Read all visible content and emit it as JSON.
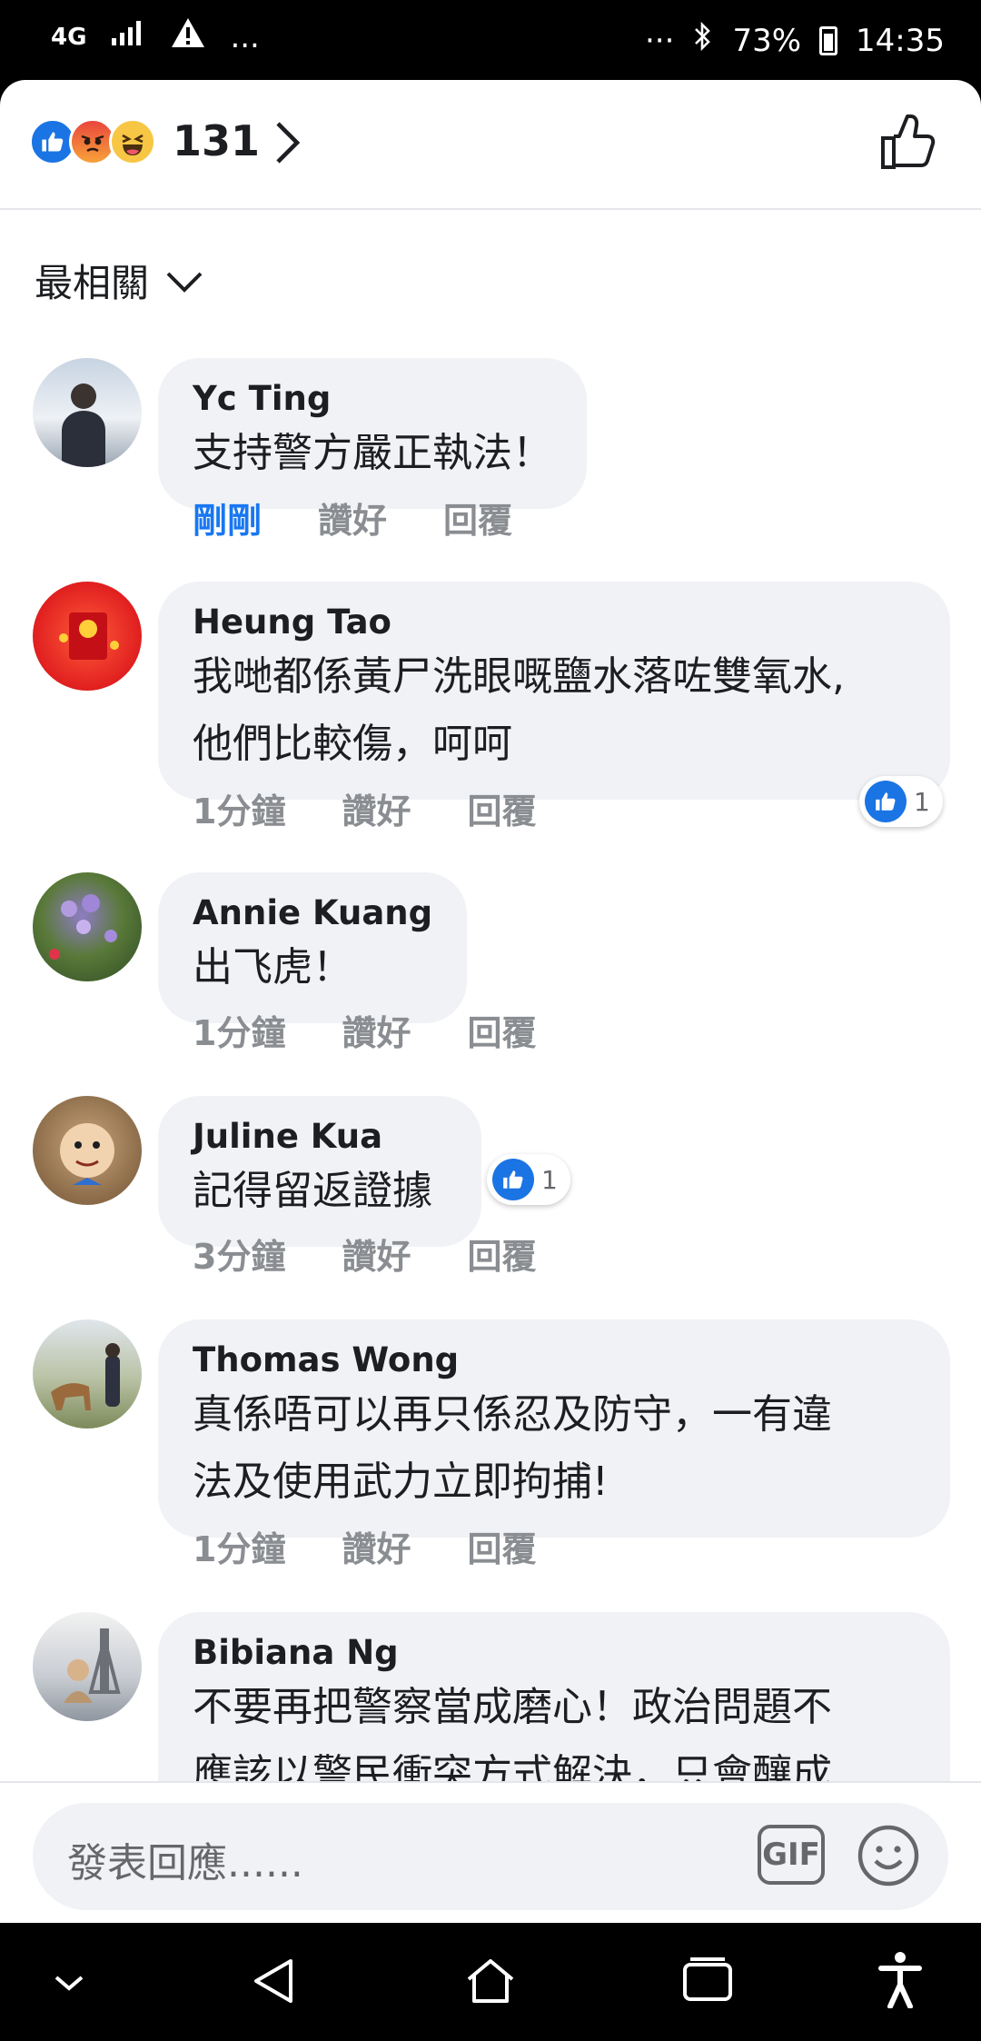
{
  "status_bar": {
    "network": "4G",
    "signal_icon": "signal-bars-icon",
    "warning_icon": "warning-icon",
    "more": "...",
    "right_more": "···",
    "bluetooth_icon": "bluetooth-icon",
    "battery": "73%",
    "time": "14:35"
  },
  "reactions": {
    "icons": [
      "like-reaction",
      "angry-reaction",
      "haha-reaction"
    ],
    "count": "131"
  },
  "sort": {
    "label": "最相關"
  },
  "comments": [
    {
      "author": "Yc Ting",
      "lines": [
        "支持警方嚴正執法！"
      ],
      "time": "剛剛",
      "like": "讚好",
      "reply": "回覆",
      "likes": ""
    },
    {
      "author": "Heung Tao",
      "lines": [
        "我哋都係黃尸洗眼嘅鹽水落咗雙氧水,",
        "他們比較傷，呵呵"
      ],
      "time": "1分鐘",
      "like": "讚好",
      "reply": "回覆",
      "likes": "1"
    },
    {
      "author": "Annie Kuang",
      "lines": [
        "出飞虎！"
      ],
      "time": "1分鐘",
      "like": "讚好",
      "reply": "回覆",
      "likes": ""
    },
    {
      "author": "Juline Kua",
      "lines": [
        "記得留返證據"
      ],
      "time": "3分鐘",
      "like": "讚好",
      "reply": "回覆",
      "likes": "1"
    },
    {
      "author": "Thomas  Wong",
      "lines": [
        "真係唔可以再只係忍及防守，一有違",
        "法及使用武力立即拘捕!"
      ],
      "time": "1分鐘",
      "like": "讚好",
      "reply": "回覆",
      "likes": ""
    },
    {
      "author": "Bibiana Ng",
      "lines": [
        "不要再把警察當成磨心！政治問題不",
        "應該以警民衝突方式解決，只會釀成"
      ],
      "time": "",
      "like": "",
      "reply": "",
      "likes": ""
    }
  ],
  "compose": {
    "placeholder": "發表回應......",
    "gif_label": "GIF"
  },
  "colors": {
    "accent": "#1877f2",
    "bubble": "#f0f2f5",
    "meta": "#8a8d91"
  }
}
